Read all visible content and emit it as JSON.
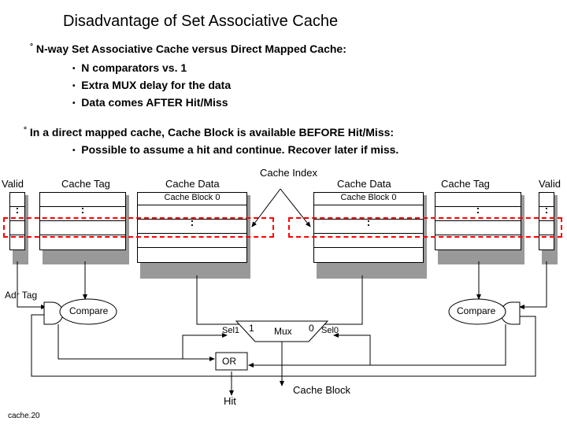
{
  "title": "Disadvantage of Set Associative Cache",
  "bullets": {
    "main1": "N-way Set Associative Cache versus Direct Mapped Cache:",
    "sub1": "N comparators vs. 1",
    "sub2": "Extra MUX delay for the data",
    "sub3": "Data comes AFTER Hit/Miss",
    "main2": "In a direct mapped cache, Cache Block is available BEFORE Hit/Miss:",
    "main2b": "Possible to assume a hit and continue.  Recover later if miss."
  },
  "labels": {
    "valid_l": "Valid",
    "tag_l": "Cache Tag",
    "data_l": "Cache Data",
    "index": "Cache Index",
    "data_r": "Cache Data",
    "tag_r": "Cache Tag",
    "valid_r": "Valid",
    "block0_l": "Cache Block 0",
    "block0_r": "Cache Block 0",
    "adr_tag": "Adr Tag",
    "compare_l": "Compare",
    "compare_r": "Compare",
    "sel1": "Sel1",
    "sel0": "Sel0",
    "one": "1",
    "zero": "0",
    "mux": "Mux",
    "or": "OR",
    "hit": "Hit",
    "cache_block": "Cache Block"
  },
  "footer": "cache.20"
}
